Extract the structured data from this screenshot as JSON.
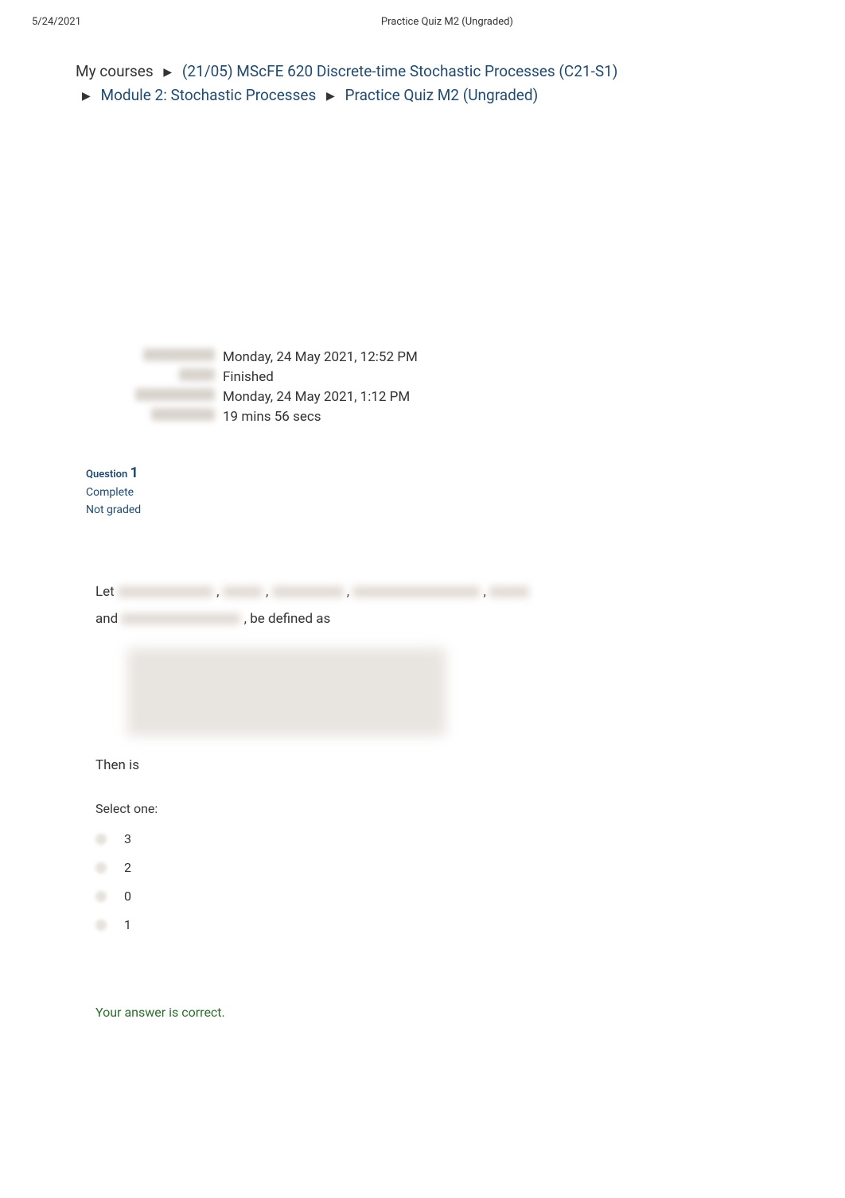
{
  "meta": {
    "date": "5/24/2021",
    "title": "Practice Quiz M2 (Ungraded)"
  },
  "breadcrumb": {
    "root": "My courses",
    "course": "(21/05) MScFE 620 Discrete-time Stochastic Processes (C21-S1)",
    "module": "Module 2: Stochastic Processes",
    "page": "Practice Quiz M2 (Ungraded)"
  },
  "summary": {
    "started": "Monday, 24 May 2021, 12:52 PM",
    "state": "Finished",
    "completed": "Monday, 24 May 2021, 1:12 PM",
    "time_taken": "19 mins 56 secs"
  },
  "question": {
    "label": "Question",
    "number": "1",
    "status1": "Complete",
    "status2": "Not graded",
    "let": "Let",
    "and": "and",
    "defined_as": ", be defined as",
    "then": "Then",
    "is": "is",
    "select_one": "Select one:",
    "options": [
      "3",
      "2",
      "0",
      "1"
    ]
  },
  "feedback": {
    "text": "Your answer is correct."
  }
}
